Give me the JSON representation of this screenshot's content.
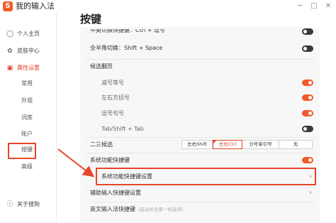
{
  "window": {
    "title": "我的输入法",
    "logo_text": "S",
    "minimize_glyph": "─",
    "maximize_glyph": "□",
    "close_glyph": "✕"
  },
  "sidebar": {
    "items": [
      {
        "label": "个人主页",
        "icon": "user-icon",
        "glyph": "◯"
      },
      {
        "label": "皮肤中心",
        "icon": "skin-icon",
        "glyph": "✿"
      },
      {
        "label": "属性设置",
        "icon": "settings-icon",
        "glyph": "▣"
      }
    ],
    "sub_items": [
      "常用",
      "外观",
      "词库",
      "账户",
      "按键",
      "高级"
    ],
    "footer": {
      "label": "关于搜狗",
      "icon": "info-icon",
      "glyph": "ⓘ"
    }
  },
  "main": {
    "title": "按键",
    "rows": {
      "partial_top": "中英切换快捷键：Ctrl + 逗号",
      "full_half": "全半角切换：Shift + Space",
      "candidate_page": "候选翻页",
      "minus_equal": "减号等号",
      "brackets": "左右方括号",
      "comma_period": "逗号句号",
      "tab_shift_tab": "Tab/Shift + Tab",
      "second_third": "二三候选",
      "sys_shortcut": "系统功能快捷键",
      "sys_shortcut_settings": "系统功能快捷键设置",
      "aux_shortcut": "辅助输入快捷键设置",
      "en_shortcut": "英文输入法快捷键",
      "en_shortcut_hint": "(启动补全第一候选项)"
    },
    "candidate_options": [
      "左右Shift",
      "左右Ctrl",
      "分号单引号",
      "无"
    ],
    "candidate_selected": "左右Ctrl",
    "toggles": {
      "partial_top": false,
      "full_half": false,
      "minus_equal": true,
      "brackets": true,
      "comma_period": true,
      "tab_shift_tab": false,
      "sys_shortcut": true
    },
    "chevron_glyph": "›"
  },
  "colors": {
    "accent": "#e0452a",
    "toggle_on": "#f05a2b",
    "toggle_off": "#3a3a3a",
    "highlight_box": "#e8452a"
  }
}
